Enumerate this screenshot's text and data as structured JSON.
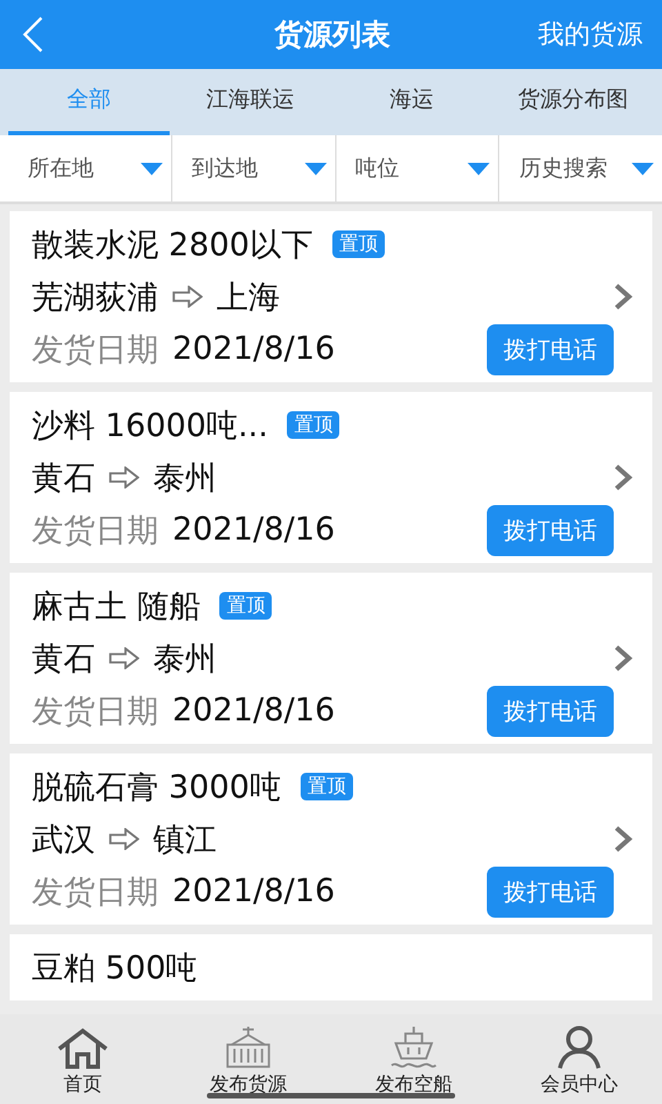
{
  "header": {
    "title": "货源列表",
    "action": "我的货源"
  },
  "tabs": [
    {
      "label": "全部",
      "selected": true
    },
    {
      "label": "江海联运",
      "selected": false
    },
    {
      "label": "海运",
      "selected": false
    },
    {
      "label": "货源分布图",
      "selected": false
    }
  ],
  "filters": [
    "所在地",
    "到达地",
    "吨位",
    "历史搜索"
  ],
  "cargo": [
    {
      "title": "散装水泥 2800以下",
      "tag": "置顶",
      "from": "芜湖荻浦",
      "to": "上海",
      "date_label": "发货日期",
      "date": "2021/8/16",
      "call": "拨打电话"
    },
    {
      "title": "沙料 16000吨...",
      "tag": "置顶",
      "from": "黄石",
      "to": "泰州",
      "date_label": "发货日期",
      "date": "2021/8/16",
      "call": "拨打电话"
    },
    {
      "title": "麻古土 随船",
      "tag": "置顶",
      "from": "黄石",
      "to": "泰州",
      "date_label": "发货日期",
      "date": "2021/8/16",
      "call": "拨打电话"
    },
    {
      "title": "脱硫石膏 3000吨",
      "tag": "置顶",
      "from": "武汉",
      "to": "镇江",
      "date_label": "发货日期",
      "date": "2021/8/16",
      "call": "拨打电话"
    },
    {
      "title": "豆粕 500吨"
    }
  ],
  "nav": [
    {
      "label": "首页",
      "kind": "home"
    },
    {
      "label": "发布货源",
      "kind": "container"
    },
    {
      "label": "发布空船",
      "kind": "ship"
    },
    {
      "label": "会员中心",
      "kind": "member"
    }
  ]
}
